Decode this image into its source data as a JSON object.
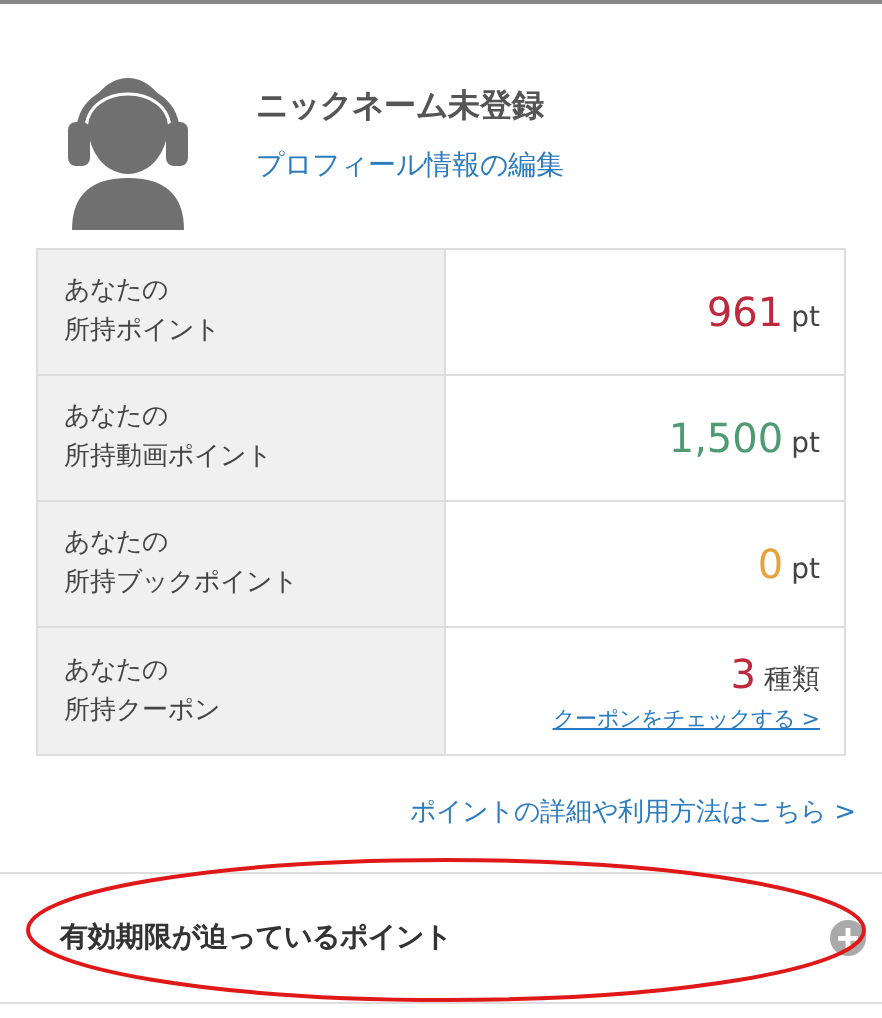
{
  "profile": {
    "nickname": "ニックネーム未登録",
    "edit_link": "プロフィール情報の編集"
  },
  "points": [
    {
      "kind": "points",
      "label_line1": "あなたの",
      "label_line2": "所持ポイント",
      "value": "961",
      "unit": "pt",
      "color": "#c0283c"
    },
    {
      "kind": "points",
      "label_line1": "あなたの",
      "label_line2": "所持動画ポイント",
      "value": "1,500",
      "unit": "pt",
      "color": "#4e9a72"
    },
    {
      "kind": "points",
      "label_line1": "あなたの",
      "label_line2": "所持ブックポイント",
      "value": "0",
      "unit": "pt",
      "color": "#e8a23c"
    },
    {
      "kind": "coupon",
      "label_line1": "あなたの",
      "label_line2": "所持クーポン",
      "value": "3",
      "unit": "種類",
      "color": "#c0283c",
      "link": "クーポンをチェックする >"
    }
  ],
  "details_link": "ポイントの詳細や利用方法はこちら >",
  "expiring_section": {
    "title": "有効期限が迫っているポイント",
    "expanded": false,
    "highlighted": true
  }
}
